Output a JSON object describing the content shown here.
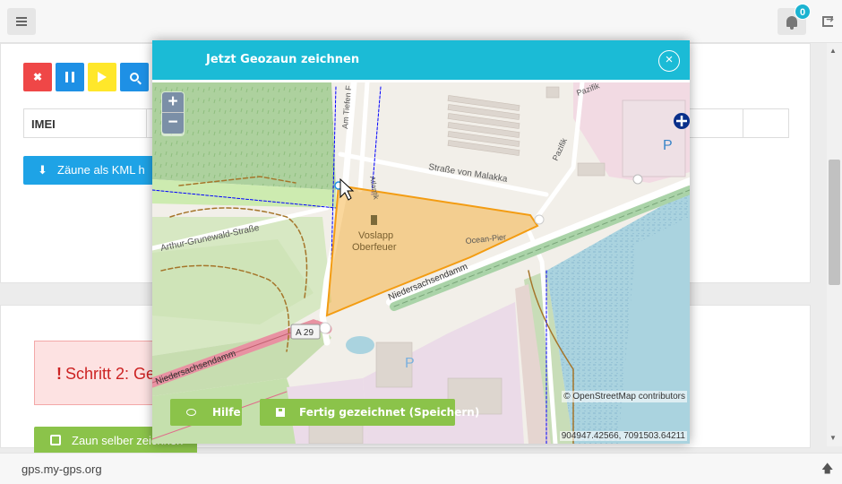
{
  "footer": {
    "site": "gps.my-gps.org"
  },
  "header": {
    "notification_count": "0"
  },
  "toolbar": {
    "stop_label": "✖",
    "table_imei_header": "IMEI",
    "kml_button_label": "Zäune als KML h"
  },
  "step": {
    "alert_text": "Schritt 2: Ge",
    "alert_mark": "!",
    "draw_button_label": "Zaun selber zeichnen"
  },
  "modal": {
    "title": "Jetzt Geozaun zeichnen",
    "close_label": "×",
    "zoom_in": "+",
    "zoom_out": "−",
    "attribution": "© OpenStreetMap contributors",
    "coordinates": "904947.42566, 7091503.64211",
    "help_button": "Hilfe",
    "save_button": "Fertig gezeichnet (Speichern)"
  },
  "map_labels": {
    "poi_name_1": "Voslapp",
    "poi_name_2": "Oberfeuer",
    "street_1": "Straße von Malakka",
    "street_2": "Arthur-Grunewald-Straße",
    "street_3": "Niedersachsendamm",
    "street_4": "Niedersachsendamm",
    "street_5": "Ocean-Pier",
    "street_6": "Pazifik",
    "street_7": "Pazifik",
    "street_8": "Am Tiefen F",
    "street_9": "Atlantik",
    "route": "A 29",
    "parking_1": "P",
    "parking_2": "P"
  },
  "colors": {
    "primary_blue": "#1ea3e6",
    "modal_header": "#1bbbd6",
    "success_green": "#8bc34a",
    "danger_red": "#ef4747",
    "warning_yellow": "#ffe72a",
    "geofence_fill": "#f5a623"
  }
}
